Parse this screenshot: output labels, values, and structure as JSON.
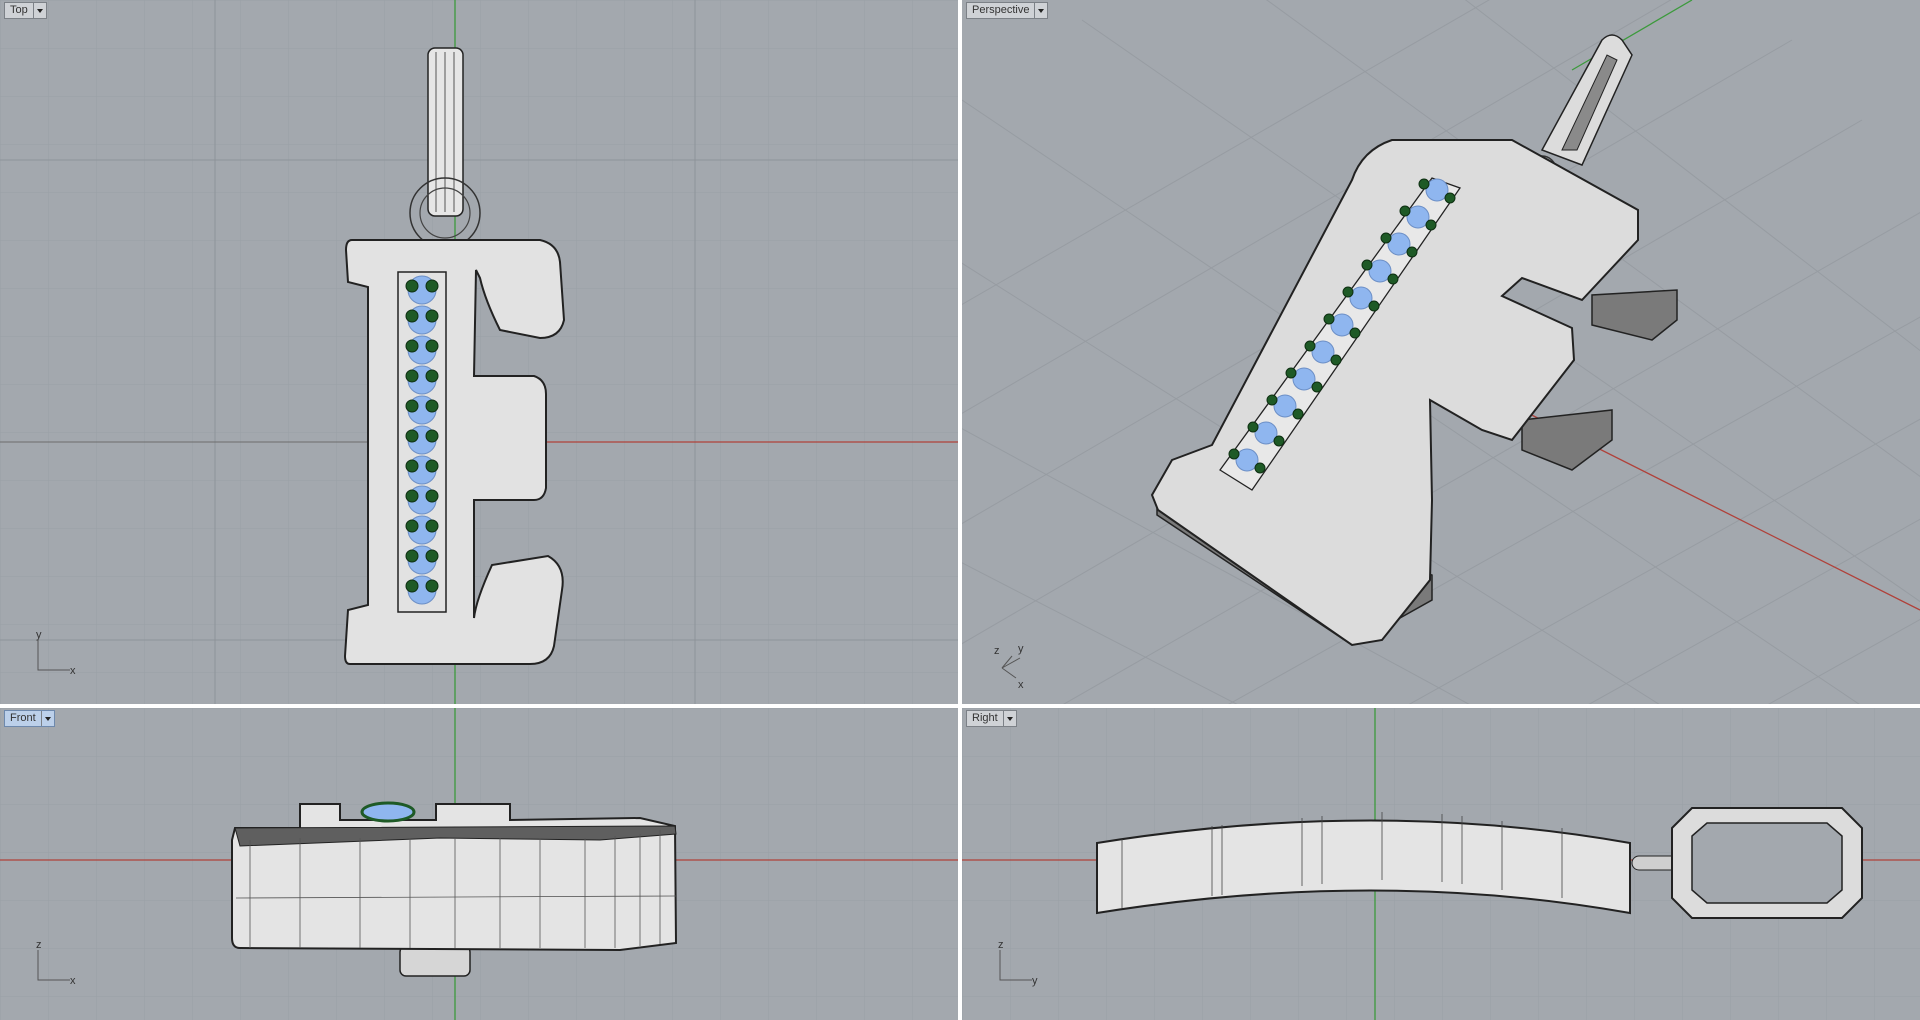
{
  "viewports": {
    "top": {
      "label": "Top",
      "axis_a": "y",
      "axis_b": "x"
    },
    "perspective": {
      "label": "Perspective",
      "axis_a": "z",
      "axis_b": "y",
      "axis_c": "x"
    },
    "front": {
      "label": "Front",
      "axis_a": "z",
      "axis_b": "x"
    },
    "right": {
      "label": "Right",
      "axis_a": "z",
      "axis_b": "y"
    }
  },
  "colors": {
    "viewport_bg": "#a3a8ae",
    "grid_minor": "#9aa0a6",
    "grid_major": "#8e9399",
    "x_axis": "#b0413a",
    "y_axis": "#3c9a3c",
    "model_fill": "#e4e4e4",
    "model_dark": "#5f5f5f",
    "gem_blue": "#8fb6ef",
    "prong_green": "#1e5a26",
    "active_tab": "#bcd0ea"
  },
  "icons": [
    "viewport-menu-dropdown-icon",
    "axis-triad-icon"
  ]
}
